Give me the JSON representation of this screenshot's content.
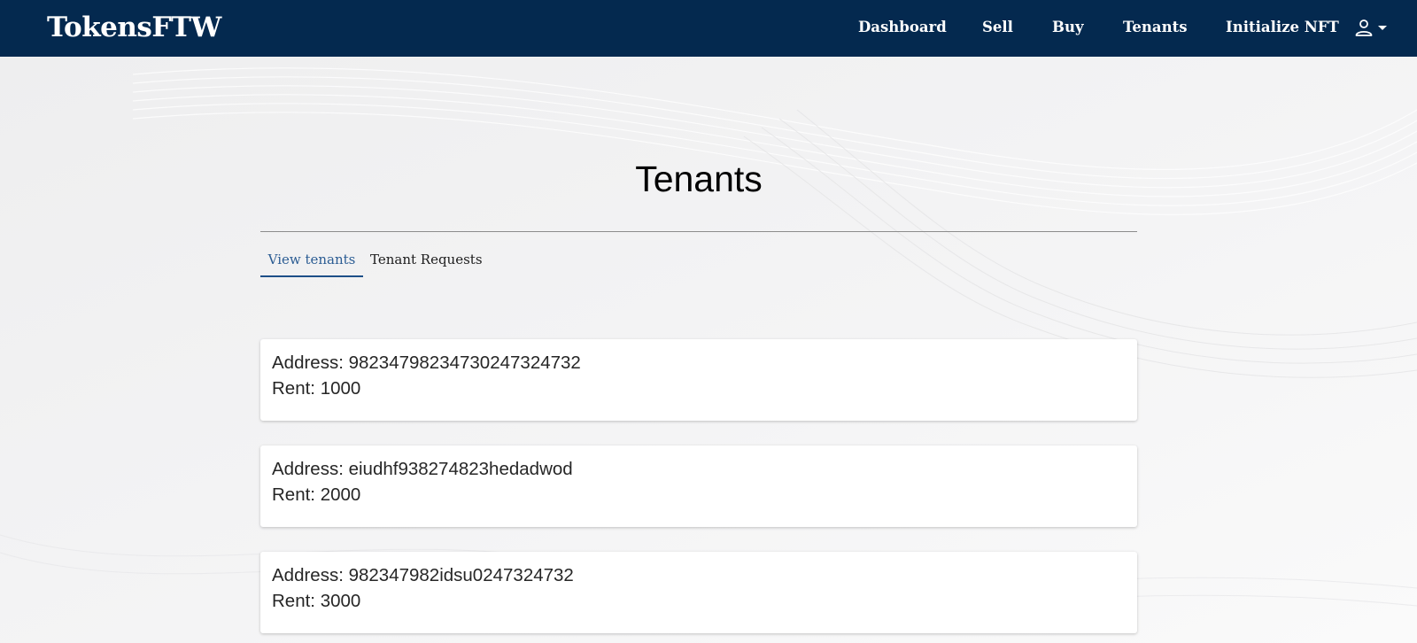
{
  "navbar": {
    "brand": "TokensFTW",
    "links": [
      {
        "label": "Dashboard"
      },
      {
        "label": "Sell"
      },
      {
        "label": "Buy"
      },
      {
        "label": "Tenants"
      },
      {
        "label": "Initialize NFT"
      }
    ],
    "user_menu_icons": [
      "person-icon",
      "caret-down-icon"
    ]
  },
  "page": {
    "title": "Tenants"
  },
  "tabs": [
    {
      "label": "View tenants",
      "active": true
    },
    {
      "label": "Tenant Requests",
      "active": false
    }
  ],
  "tenants": [
    {
      "address": "Address: 98234798234730247324732",
      "rent": "Rent: 1000"
    },
    {
      "address": "Address: eiudhf938274823hedadwod",
      "rent": "Rent: 2000"
    },
    {
      "address": "Address: 982347982idsu0247324732",
      "rent": "Rent: 3000"
    }
  ],
  "colors": {
    "navbar_bg": "#04294f",
    "active_tab": "#2b5c93",
    "page_bg": "#f1f1f2"
  }
}
